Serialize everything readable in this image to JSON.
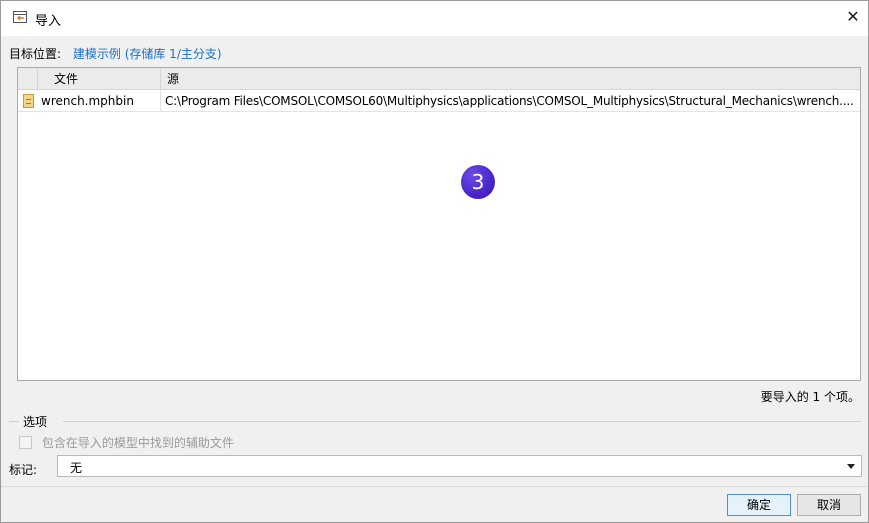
{
  "window": {
    "title": "导入",
    "close_glyph": "✕"
  },
  "target": {
    "label": "目标位置:",
    "link": "建模示例 (存储库 1/主分支)"
  },
  "table": {
    "columns": [
      "文件",
      "源"
    ],
    "rows": [
      {
        "file": "wrench.mphbin",
        "source": "C:\\Program Files\\COMSOL\\COMSOL60\\Multiphysics\\applications\\COMSOL_Multiphysics\\Structural_Mechanics\\wrench...."
      }
    ]
  },
  "badge": "3",
  "count_text": "要导入的 1 个项。",
  "options": {
    "legend": "选项",
    "checkbox_label": "包含在导入的模型中找到的辅助文件",
    "checkbox_checked": false,
    "checkbox_enabled": false
  },
  "tag": {
    "label": "标记:",
    "value": "无"
  },
  "buttons": {
    "ok": "确定",
    "cancel": "取消"
  },
  "colors": {
    "link": "#1a6fc6",
    "badge": "#4a25c9",
    "dialog_bg": "#f0f0f0"
  }
}
